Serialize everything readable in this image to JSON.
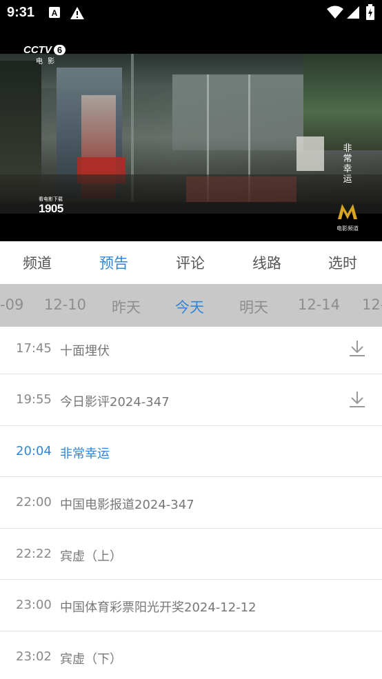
{
  "status_bar": {
    "time": "9:31",
    "icons": [
      "font-notification-icon",
      "alert-icon",
      "wifi-icon",
      "signal-icon",
      "battery-charging-icon"
    ]
  },
  "player": {
    "channel_logo": "CCTV",
    "channel_number": "6",
    "channel_sub": "电 影",
    "watermark_small": "看电影下载",
    "watermark_big": "1905",
    "vertical_title": [
      "非",
      "常",
      "幸",
      "运"
    ],
    "corner_logo_text": "电影频道"
  },
  "tabs": [
    {
      "label": "频道",
      "active": false
    },
    {
      "label": "预告",
      "active": true
    },
    {
      "label": "评论",
      "active": false
    },
    {
      "label": "线路",
      "active": false
    },
    {
      "label": "选时",
      "active": false
    }
  ],
  "dates": [
    {
      "label": "-09",
      "active": false
    },
    {
      "label": "12-10",
      "active": false
    },
    {
      "label": "昨天",
      "active": false
    },
    {
      "label": "今天",
      "active": true
    },
    {
      "label": "明天",
      "active": false
    },
    {
      "label": "12-14",
      "active": false
    },
    {
      "label": "12-",
      "active": false
    }
  ],
  "programs": [
    {
      "time": "17:45",
      "title": "十面埋伏",
      "download": true,
      "active": false
    },
    {
      "time": "19:55",
      "title": "今日影评2024-347",
      "download": true,
      "active": false
    },
    {
      "time": "20:04",
      "title": "非常幸运",
      "download": false,
      "active": true
    },
    {
      "time": "22:00",
      "title": "中国电影报道2024-347",
      "download": false,
      "active": false
    },
    {
      "time": "22:22",
      "title": "宾虚（上）",
      "download": false,
      "active": false
    },
    {
      "time": "23:00",
      "title": "中国体育彩票阳光开奖2024-12-12",
      "download": false,
      "active": false
    },
    {
      "time": "23:02",
      "title": "宾虚（下）",
      "download": false,
      "active": false
    }
  ],
  "colors": {
    "accent": "#2f86d6",
    "date_strip_bg": "#c8c8c8",
    "text_muted": "#888888"
  }
}
